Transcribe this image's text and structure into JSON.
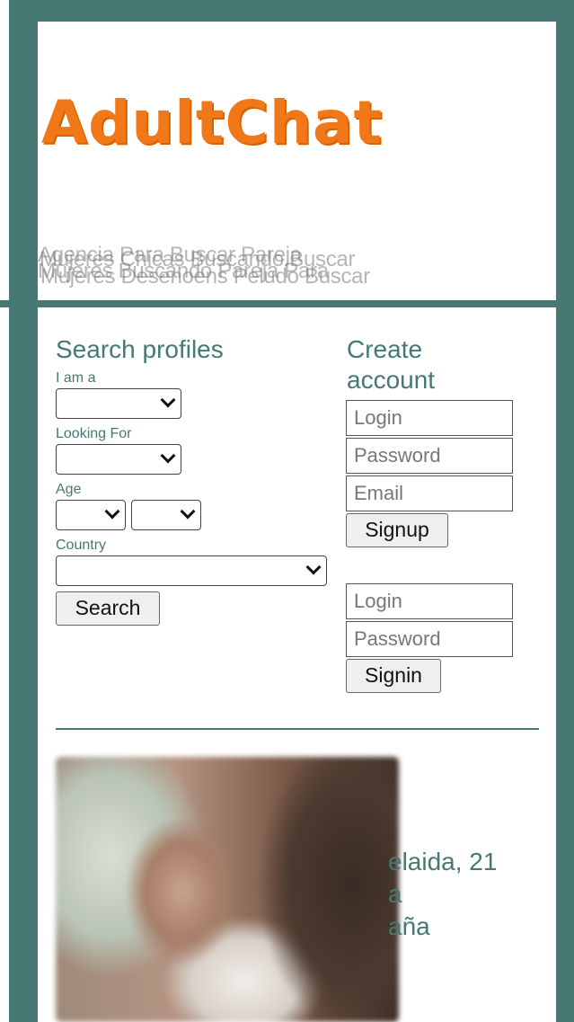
{
  "header": {
    "logo": "AdultChat",
    "taglines": [
      "Agencia Para Buscar Pareja",
      "Mujeres Chicas Buscando Buscar",
      "Mujeres Buscando Pareja Para",
      "Mujeres Desenoens Peludo Buscar"
    ]
  },
  "search": {
    "title": "Search profiles",
    "iam_label": "I am a",
    "looking_label": "Looking For",
    "age_label": "Age",
    "country_label": "Country",
    "search_button": "Search"
  },
  "account": {
    "title_line1": "Create",
    "title_line2": "account",
    "signup_login_placeholder": "Login",
    "signup_password_placeholder": "Password",
    "signup_email_placeholder": "Email",
    "signup_button": "Signup",
    "signin_login_placeholder": "Login",
    "signin_password_placeholder": "Password",
    "signin_button": "Signin"
  },
  "profile": {
    "line1": "elaida, 21",
    "line2": "a",
    "line3": "aña"
  },
  "colors": {
    "accent": "#467874",
    "logo": "#f07818"
  },
  "icons": {
    "dropdown": "chevron-down-icon"
  }
}
